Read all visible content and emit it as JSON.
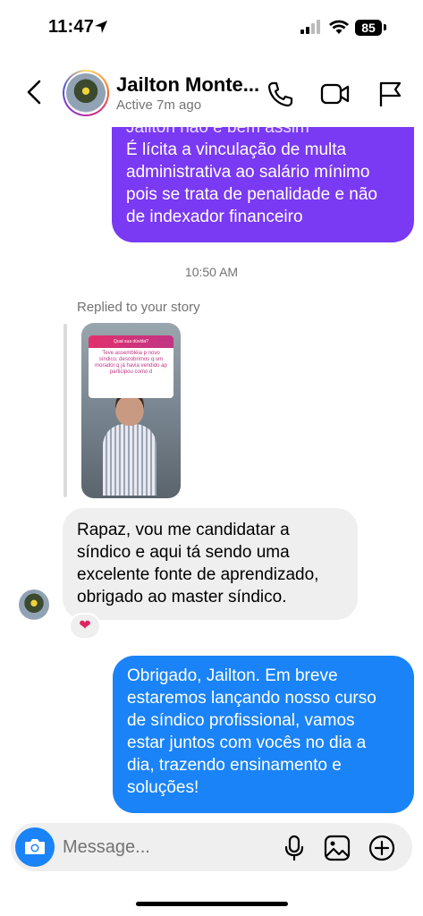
{
  "status_bar": {
    "time": "11:47",
    "battery": "85"
  },
  "header": {
    "contact_name": "Jailton Monte...",
    "contact_status": "Active 7m ago"
  },
  "messages": {
    "outgoing_1_lines": [
      "Jailton não é bem assim",
      "É lícita a vinculação de multa",
      "administrativa ao salário mínimo",
      "pois se trata de penalidade e não",
      "de indexador financeiro"
    ],
    "time_divider": "10:50 AM",
    "replied_label": "Replied to your story",
    "story": {
      "question_title": "Qual sua dúvida?",
      "question_text": "Teve assembléia p novo síndico, descobrimos q um morador q já havia vendido ap participou como d"
    },
    "incoming_1_lines": [
      "Rapaz, vou me candidatar a",
      "síndico e aqui tá sendo uma",
      "excelente fonte de aprendizado,",
      "obrigado ao master síndico."
    ],
    "reaction": "❤",
    "outgoing_2_lines": [
      "Obrigado, Jailton. Em breve",
      "estaremos lançando nosso curso",
      "de síndico profissional, vamos",
      "estar juntos com vocês no dia a",
      "dia, trazendo ensinamento e",
      "soluções!"
    ]
  },
  "composer": {
    "placeholder": "Message..."
  },
  "colors": {
    "outgoing_purple": "#7a39f2",
    "outgoing_blue": "#1a83f7",
    "incoming_gray": "#efefef",
    "muted_text": "#737373"
  },
  "icons": [
    "back-chevron-icon",
    "phone-icon",
    "video-icon",
    "flag-icon",
    "camera-icon",
    "microphone-icon",
    "gallery-icon",
    "plus-circle-icon",
    "location-arrow-icon",
    "signal-icon",
    "wifi-icon",
    "heart-icon"
  ]
}
